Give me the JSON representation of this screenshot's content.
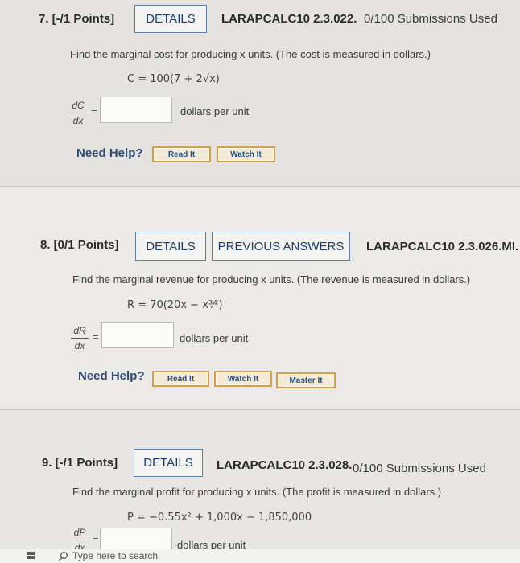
{
  "q7": {
    "number": "7. [-/1 Points]",
    "details": "DETAILS",
    "code": "LARAPCALC10 2.3.022.",
    "submissions": "0/100 Submissions Used",
    "prompt": "Find the marginal cost for producing x units. (The cost is measured in dollars.)",
    "formula": "C = 100(7 + 2√x)",
    "deriv_num": "dC",
    "deriv_den": "dx",
    "unit": "dollars per unit",
    "answer": ""
  },
  "q8": {
    "number": "8. [0/1 Points]",
    "details": "DETAILS",
    "previous": "PREVIOUS ANSWERS",
    "code": "LARAPCALC10 2.3.026.MI.",
    "prompt": "Find the marginal revenue for producing x units. (The revenue is measured in dollars.)",
    "formula": "R = 70(20x − x³⁄²)",
    "deriv_num": "dR",
    "deriv_den": "dx",
    "unit": "dollars per unit",
    "answer": ""
  },
  "q9": {
    "number": "9. [-/1 Points]",
    "details": "DETAILS",
    "code": "LARAPCALC10 2.3.028.",
    "submissions": "0/100 Submissions Used",
    "prompt": "Find the marginal profit for producing x units. (The profit is measured in dollars.)",
    "formula": "P = −0.55x² + 1,000x − 1,850,000",
    "deriv_num": "dP",
    "deriv_den": "dx",
    "unit": "dollars per unit",
    "answer": ""
  },
  "help": {
    "need_help": "Need Help?",
    "read_it": "Read It",
    "watch_it": "Watch It",
    "master_it": "Master It"
  },
  "taskbar": {
    "search_placeholder": "Type here to search"
  },
  "colors": {
    "accent": "#1d3d6b",
    "help_border": "#d2a04a"
  }
}
